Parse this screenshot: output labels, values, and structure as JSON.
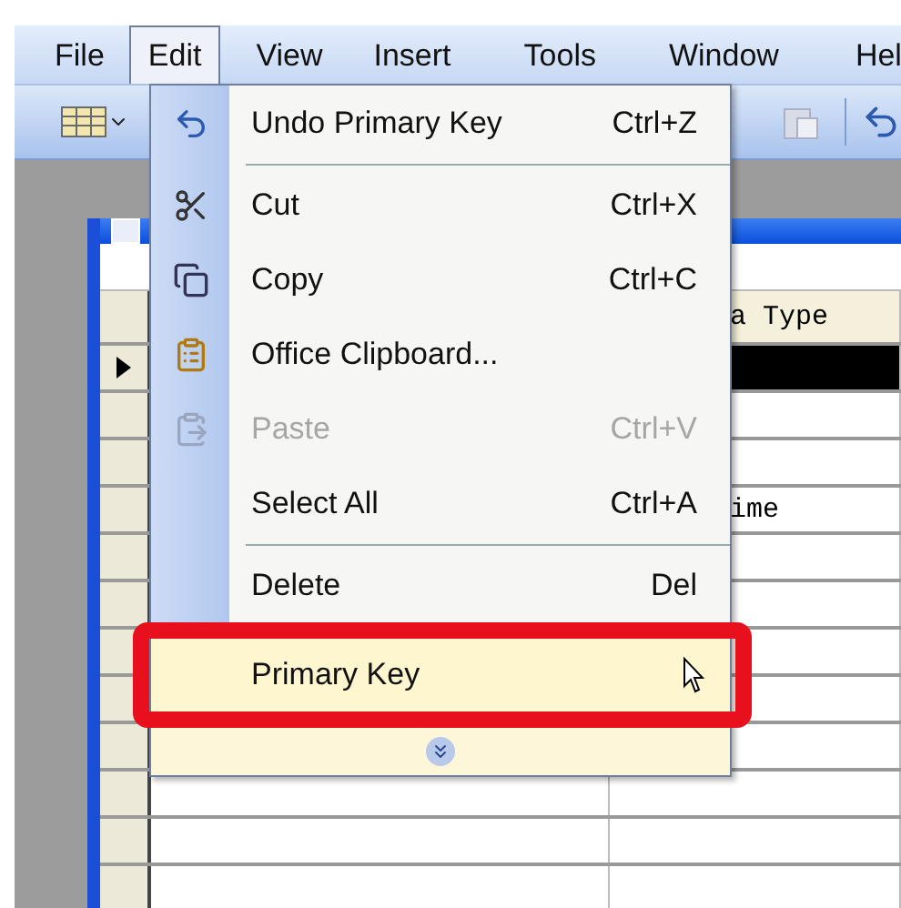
{
  "menu_bar": {
    "items": [
      {
        "label": "File",
        "selected": false
      },
      {
        "label": "Edit",
        "selected": true
      },
      {
        "label": "View",
        "selected": false
      },
      {
        "label": "Insert",
        "selected": false
      },
      {
        "label": "Tools",
        "selected": false
      },
      {
        "label": "Window",
        "selected": false
      },
      {
        "label": "Hel",
        "selected": false
      }
    ]
  },
  "edit_menu": {
    "items": [
      {
        "kind": "item",
        "label": "Undo Primary Key",
        "shortcut": "Ctrl+Z",
        "disabled": false,
        "highlighted": false
      },
      {
        "kind": "separator"
      },
      {
        "kind": "item",
        "label": "Cut",
        "shortcut": "Ctrl+X",
        "disabled": false,
        "highlighted": false
      },
      {
        "kind": "item",
        "label": "Copy",
        "shortcut": "Ctrl+C",
        "disabled": false,
        "highlighted": false
      },
      {
        "kind": "item",
        "label": "Office Clipboard...",
        "disabled": false,
        "highlighted": false
      },
      {
        "kind": "item",
        "label": "Paste",
        "shortcut": "Ctrl+V",
        "disabled": true,
        "highlighted": false
      },
      {
        "kind": "item",
        "label": "Select All",
        "shortcut": "Ctrl+A",
        "disabled": false,
        "highlighted": false
      },
      {
        "kind": "separator"
      },
      {
        "kind": "item",
        "label": "Delete",
        "shortcut": "Del",
        "disabled": false,
        "highlighted": false
      },
      {
        "kind": "item",
        "label": "Primary Key",
        "disabled": false,
        "highlighted": true,
        "annotated": true
      },
      {
        "kind": "expand"
      }
    ]
  },
  "table": {
    "column_2_header": "a Type",
    "rows": [
      {
        "selected": true
      },
      {
        "selected": false
      },
      {
        "selected": false
      },
      {
        "selected": false,
        "column_2": "ime"
      },
      {
        "selected": false
      },
      {
        "selected": false
      },
      {
        "selected": false
      },
      {
        "selected": false
      },
      {
        "selected": false
      },
      {
        "selected": false
      },
      {
        "selected": false
      },
      {
        "selected": false
      }
    ]
  }
}
